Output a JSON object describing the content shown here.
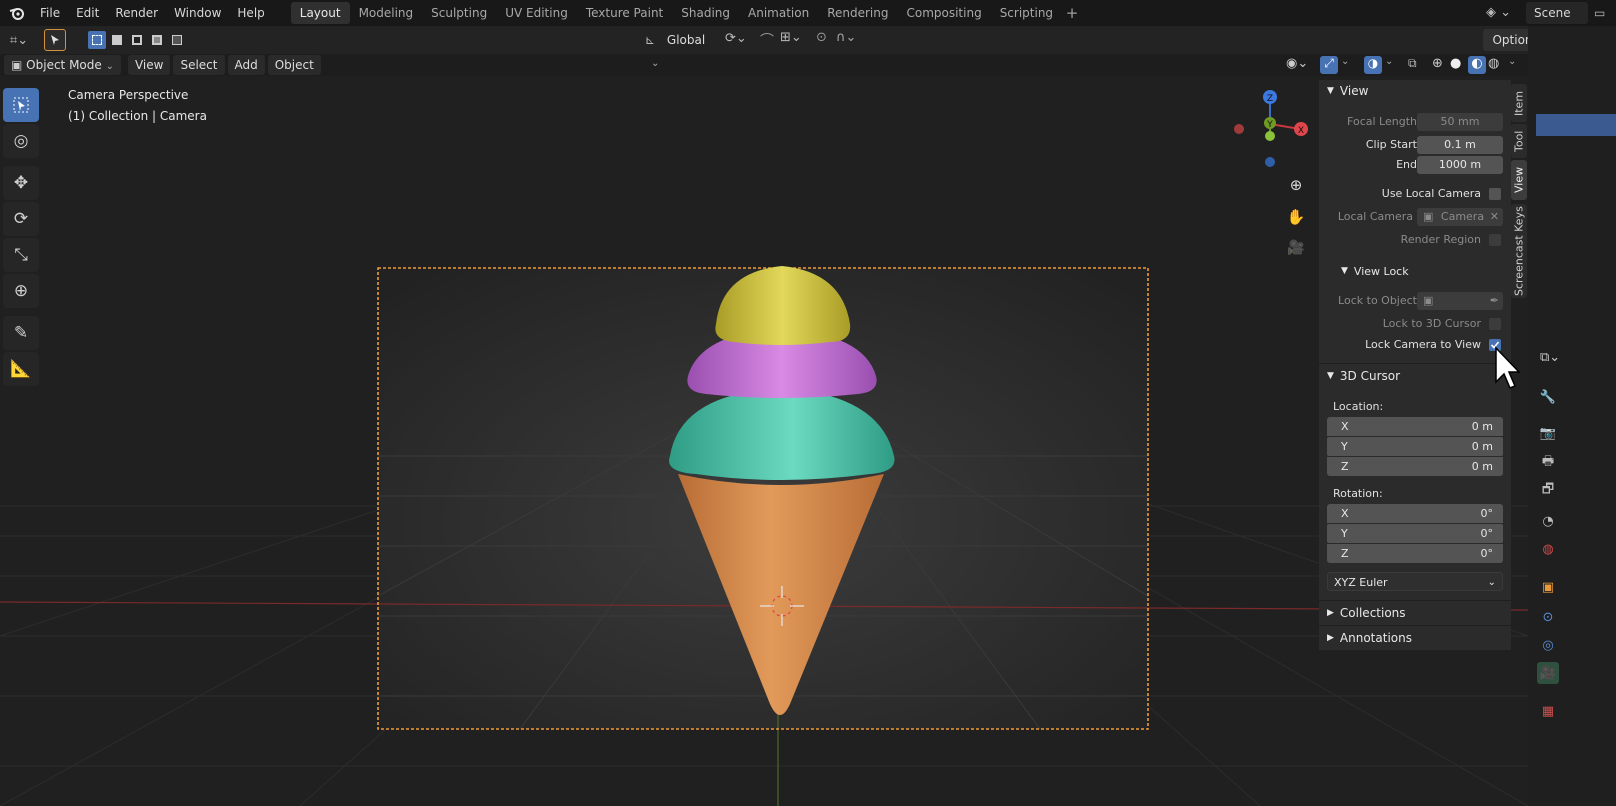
{
  "menu": [
    "File",
    "Edit",
    "Render",
    "Window",
    "Help"
  ],
  "workspaces": [
    "Layout",
    "Modeling",
    "Sculpting",
    "UV Editing",
    "Texture Paint",
    "Shading",
    "Animation",
    "Rendering",
    "Compositing",
    "Scripting"
  ],
  "scene": "Scene",
  "toolheader": {
    "orientation": "Global",
    "options": "Options"
  },
  "viewport_header": {
    "mode": "Object Mode",
    "view": "View",
    "select": "Select",
    "add": "Add",
    "object": "Object"
  },
  "viewport": {
    "perspective": "Camera Perspective",
    "collection": "(1) Collection | Camera"
  },
  "gizmo": {
    "z": "Z",
    "y": "Y",
    "x": "X"
  },
  "npanel": {
    "view_title": "View",
    "focal_length_label": "Focal Length",
    "focal_length": "50 mm",
    "clip_start_label": "Clip Start",
    "clip_start": "0.1 m",
    "end_label": "End",
    "end": "1000 m",
    "use_local_camera": "Use Local Camera",
    "local_camera_label": "Local Camera",
    "local_camera": "Camera",
    "render_region": "Render Region",
    "view_lock_title": "View Lock",
    "lock_to_object": "Lock to Object",
    "lock_to_cursor": "Lock to 3D Cursor",
    "lock_camera_to_view": "Lock Camera to View",
    "cursor_title": "3D Cursor",
    "location_label": "Location:",
    "location": [
      {
        "axis": "X",
        "value": "0 m"
      },
      {
        "axis": "Y",
        "value": "0 m"
      },
      {
        "axis": "Z",
        "value": "0 m"
      }
    ],
    "rotation_label": "Rotation:",
    "rotation": [
      {
        "axis": "X",
        "value": "0°"
      },
      {
        "axis": "Y",
        "value": "0°"
      },
      {
        "axis": "Z",
        "value": "0°"
      }
    ],
    "rotation_mode": "XYZ Euler",
    "collections": "Collections",
    "annotations": "Annotations"
  },
  "vtabs": [
    "Item",
    "Tool",
    "View",
    "Screencast Keys"
  ],
  "colors": {
    "accent": "#4772b3",
    "selection": "#f09a35",
    "cone": "#d4884c",
    "scoop_yellow": "#cfc442",
    "scoop_pink": "#c27ad0",
    "scoop_teal": "#4fbfa6"
  }
}
